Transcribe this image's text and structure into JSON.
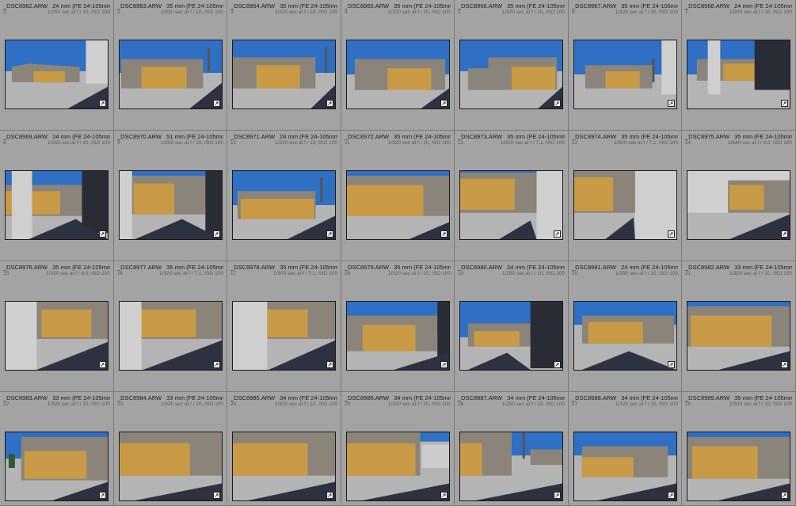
{
  "app": {
    "view": "Library Grid",
    "colors": {
      "cell_bg": "#a3a3a3",
      "sky": "#2f6fc4",
      "wall": "#8a847a",
      "door": "#c89a45",
      "ground": "#b4b4b4",
      "shadow": "#2e3140"
    },
    "badge_icon": "edit-badge-icon"
  },
  "photos": [
    {
      "filename": "_DSC8962.ARW",
      "lens": "24 mm (FE 24-105mm F4...",
      "index": "1",
      "exposure": "1/250 sec at f / 10, ISO 100"
    },
    {
      "filename": "_DSC8963.ARW",
      "lens": "35 mm (FE 24-105mm F4...",
      "index": "2",
      "exposure": "1/320 sec at f / 10, ISO 100"
    },
    {
      "filename": "_DSC8964.ARW",
      "lens": "35 mm (FE 24-105mm F4...",
      "index": "3",
      "exposure": "1/320 sec at f / 10, ISO 100"
    },
    {
      "filename": "_DSC8965.ARW",
      "lens": "35 mm (FE 24-105mm F4...",
      "index": "4",
      "exposure": "1/320 sec at f / 10, ISO 100"
    },
    {
      "filename": "_DSC8966.ARW",
      "lens": "35 mm (FE 24-105mm F4...",
      "index": "5",
      "exposure": "1/320 sec at f / 10, ISO 100"
    },
    {
      "filename": "_DSC8967.ARW",
      "lens": "35 mm (FE 24-105mm F4...",
      "index": "6",
      "exposure": "1/320 sec at f / 10, ISO 100"
    },
    {
      "filename": "_DSC8968.ARW",
      "lens": "24 mm (FE 24-105mm F4...",
      "index": "7",
      "exposure": "1/200 sec at f / 10, ISO 100"
    },
    {
      "filename": "_DSC8969.ARW",
      "lens": "24 mm (FE 24-105mm F4...",
      "index": "8",
      "exposure": "1/250 sec at f / 10, ISO 100"
    },
    {
      "filename": "_DSC8970.ARW",
      "lens": "51 mm (FE 24-105mm F4 G...",
      "index": "9",
      "exposure": "1/250 sec at f / 10, ISO 100"
    },
    {
      "filename": "_DSC8971.ARW",
      "lens": "24 mm (FE 24-105mm F4 G...",
      "index": "10",
      "exposure": "1/320 sec at f / 10, ISO 100"
    },
    {
      "filename": "_DSC8972.ARW",
      "lens": "35 mm (FE 24-105mm F4...",
      "index": "11",
      "exposure": "1/320 sec at f / 10, ISO 100"
    },
    {
      "filename": "_DSC8973.ARW",
      "lens": "35 mm (FE 24-105mm F4...",
      "index": "12",
      "exposure": "1/500 sec at f / 7.1, ISO 100"
    },
    {
      "filename": "_DSC8974.ARW",
      "lens": "35 mm (FE 24-105mm F4...",
      "index": "13",
      "exposure": "1/500 sec at f / 7.1, ISO 100"
    },
    {
      "filename": "_DSC8975.ARW",
      "lens": "35 mm (FE 24-105mm F4...",
      "index": "14",
      "exposure": "1/640 sec at f / 8.0, ISO 100"
    },
    {
      "filename": "_DSC8976.ARW",
      "lens": "35 mm (FE 24-105mm F4...",
      "index": "15",
      "exposure": "1/320 sec at f / 8.0, ISO 100"
    },
    {
      "filename": "_DSC8977.ARW",
      "lens": "35 mm (FE 24-105mm F4 G...",
      "index": "16",
      "exposure": "1/320 sec at f / 7.1, ISO 100"
    },
    {
      "filename": "_DSC8978.ARW",
      "lens": "35 mm (FE 24-105mm F4...",
      "index": "17",
      "exposure": "1/500 sec at f / 7.1, ISO 100"
    },
    {
      "filename": "_DSC8979.ARW",
      "lens": "35 mm (FE 24-105mm F4...",
      "index": "18",
      "exposure": "1/320 sec at f / 10, ISO 100"
    },
    {
      "filename": "_DSC8980.ARW",
      "lens": "24 mm (FE 24-105mm F4...",
      "index": "19",
      "exposure": "1/250 sec at f / 10, ISO 100"
    },
    {
      "filename": "_DSC8981.ARW",
      "lens": "24 mm (FE 24-105mm F4...",
      "index": "20",
      "exposure": "1/250 sec at f / 10, ISO 100"
    },
    {
      "filename": "_DSC8982.ARW",
      "lens": "33 mm (FE 24-105mm F4...",
      "index": "21",
      "exposure": "1/320 sec at f / 10, ISO 100"
    },
    {
      "filename": "_DSC8983.ARW",
      "lens": "33 mm (FE 24-105mm F4...",
      "index": "22",
      "exposure": "1/320 sec at f / 10, ISO 100"
    },
    {
      "filename": "_DSC8984.ARW",
      "lens": "33 mm (FE 24-105mm F4...",
      "index": "23",
      "exposure": "1/320 sec at f / 10, ISO 100"
    },
    {
      "filename": "_DSC8985.ARW",
      "lens": "34 mm (FE 24-105mm F4...",
      "index": "24",
      "exposure": "1/320 sec at f / 10, ISO 100"
    },
    {
      "filename": "_DSC8986.ARW",
      "lens": "34 mm (FE 24-105mm F4...",
      "index": "25",
      "exposure": "1/320 sec at f / 10, ISO 100"
    },
    {
      "filename": "_DSC8987.ARW",
      "lens": "34 mm (FE 24-105mm F4...",
      "index": "26",
      "exposure": "1/250 sec at f / 10, ISO 100"
    },
    {
      "filename": "_DSC8988.ARW",
      "lens": "34 mm (FE 24-105mm F4...",
      "index": "27",
      "exposure": "1/320 sec at f / 10, ISO 100"
    },
    {
      "filename": "_DSC8989.ARW",
      "lens": "35 mm (FE 24-105mm F4...",
      "index": "28",
      "exposure": "1/500 sec at f / 10, ISO 100"
    }
  ]
}
